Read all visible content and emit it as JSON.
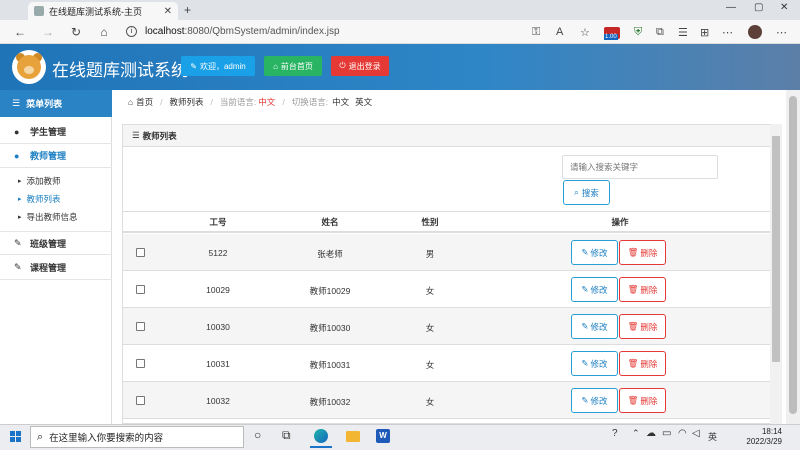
{
  "browser": {
    "tab_title": "在线题库测试系统-主页",
    "url_host": "localhost",
    "url_rest": ":8080/QbmSystem/admin/index.jsp",
    "badge": "1.00"
  },
  "header": {
    "app_title": "在线题库测试系统",
    "welcome_label": "欢迎，admin",
    "front_label": "前台首页",
    "logout_label": "退出登录"
  },
  "sidebar": {
    "title": "菜单列表",
    "items": [
      {
        "label": "学生管理"
      },
      {
        "label": "教师管理"
      },
      {
        "label": "班级管理"
      },
      {
        "label": "课程管理"
      }
    ],
    "sub_items": [
      {
        "label": "添加教师"
      },
      {
        "label": "教师列表"
      },
      {
        "label": "导出教师信息"
      }
    ]
  },
  "breadcrumb": {
    "home": "首页",
    "current": "教师列表",
    "lang_label": "当前语言:",
    "lang_value": "中文",
    "switch_label": "切换语言:",
    "lang_cn": "中文",
    "lang_en": "英文"
  },
  "panel": {
    "title": "教师列表",
    "search_placeholder": "请输入搜索关键字",
    "search_label": "搜索"
  },
  "table": {
    "headers": {
      "id": "工号",
      "name": "姓名",
      "gender": "性别",
      "ops": "操作"
    },
    "edit_label": "修改",
    "delete_label": "删除",
    "rows": [
      {
        "id": "5122",
        "name": "张老师",
        "gender": "男"
      },
      {
        "id": "10029",
        "name": "教师10029",
        "gender": "女"
      },
      {
        "id": "10030",
        "name": "教师10030",
        "gender": "女"
      },
      {
        "id": "10031",
        "name": "教师10031",
        "gender": "女"
      },
      {
        "id": "10032",
        "name": "教师10032",
        "gender": "女"
      }
    ]
  },
  "taskbar": {
    "search_placeholder": "在这里输入你要搜索的内容",
    "ime": "英",
    "time": "18:14",
    "date": "2022/3/29"
  },
  "colors": {
    "header_blue": "#1f74b8",
    "sidebar_active": "#1a7ec2",
    "welcome_btn": "#1aa0e6",
    "front_btn": "#28b463",
    "logout_btn": "#e53935"
  }
}
